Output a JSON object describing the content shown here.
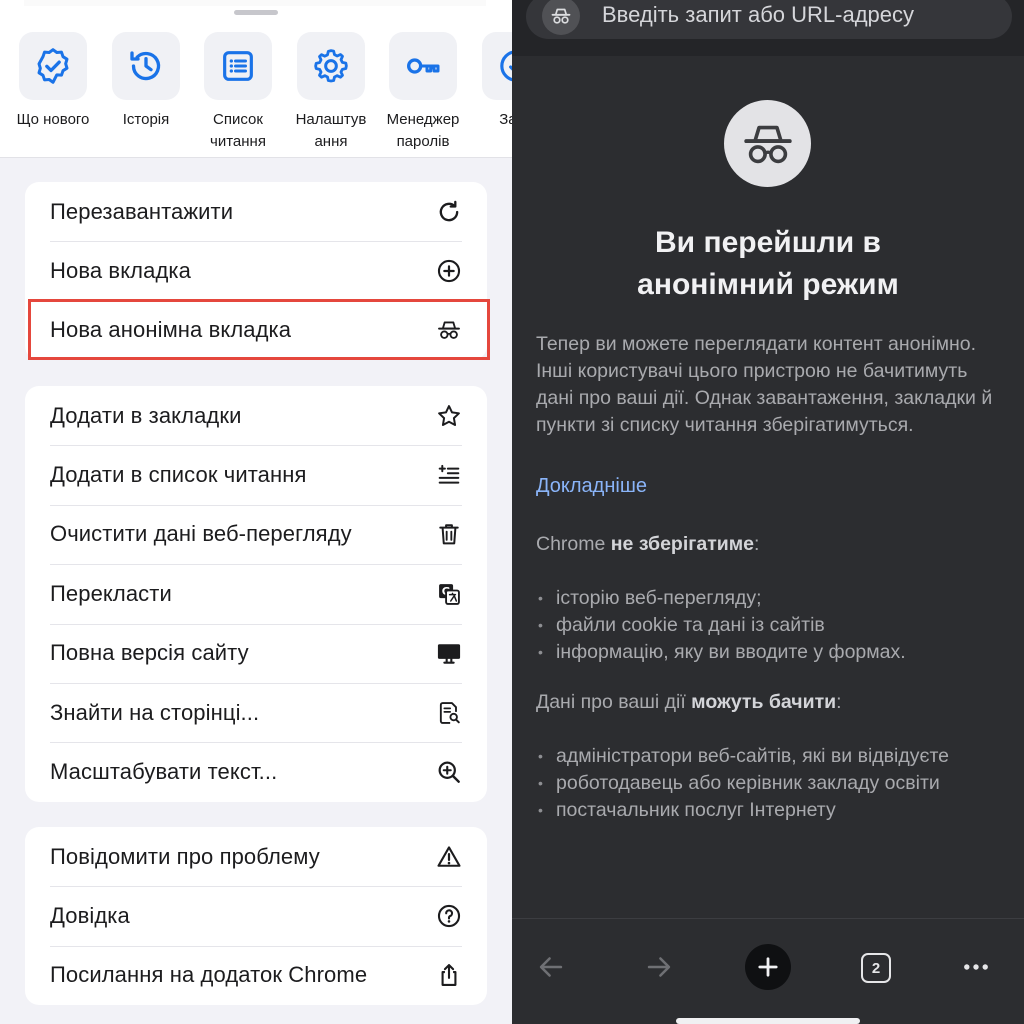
{
  "menu": {
    "quick_actions": [
      {
        "label": "Що нового",
        "icon": "verified-badge-icon"
      },
      {
        "label": "Історія",
        "icon": "history-icon"
      },
      {
        "label": "Список\nчитання",
        "icon": "reading-list-icon"
      },
      {
        "label": "Налаштув\nання",
        "icon": "gear-icon"
      },
      {
        "label": "Менеджер\nпаролів",
        "icon": "key-icon"
      },
      {
        "label": "Зава\nн",
        "icon": "download-icon"
      }
    ],
    "group1": [
      {
        "label": "Перезавантажити",
        "icon": "reload-icon"
      },
      {
        "label": "Нова вкладка",
        "icon": "plus-circle-icon"
      },
      {
        "label": "Нова анонімна вкладка",
        "icon": "incognito-icon"
      }
    ],
    "group2": [
      {
        "label": "Додати в закладки",
        "icon": "star-icon"
      },
      {
        "label": "Додати в список читання",
        "icon": "reading-list-add-icon"
      },
      {
        "label": "Очистити дані веб-перегляду",
        "icon": "trash-icon"
      },
      {
        "label": "Перекласти",
        "icon": "translate-icon"
      },
      {
        "label": "Повна версія сайту",
        "icon": "desktop-icon"
      },
      {
        "label": "Знайти на сторінці...",
        "icon": "find-in-page-icon"
      },
      {
        "label": "Масштабувати текст...",
        "icon": "zoom-in-icon"
      }
    ],
    "group3": [
      {
        "label": "Повідомити про проблему",
        "icon": "warning-icon"
      },
      {
        "label": "Довідка",
        "icon": "help-icon"
      },
      {
        "label": "Посилання на додаток Chrome",
        "icon": "share-icon"
      }
    ],
    "highlight_color": "#e5473d"
  },
  "incognito": {
    "omnibox_placeholder": "Введіть запит або URL-адресу",
    "title_line1": "Ви перейшли в",
    "title_line2": "анонімний режим",
    "intro": "Тепер ви можете переглядати контент анонімно. Інші користувачі цього пристрою не бачитимуть дані про ваші дії. Однак завантаження, закладки й пункти зі списку читання зберігатимуться.",
    "learn_more": "Докладніше",
    "not_save_prefix": "Chrome ",
    "not_save_bold": "не зберігатиме",
    "not_save_suffix": ":",
    "not_saved_items": [
      "історію веб-перегляду;",
      "файли cookie та дані із сайтів",
      "інформацію, яку ви вводите у формах."
    ],
    "visible_prefix": "Дані про ваші дії ",
    "visible_bold": "можуть бачити",
    "visible_suffix": ":",
    "visible_items": [
      "адміністратори веб-сайтів, які ви відвідуєте",
      "роботодавець або керівник закладу освіти",
      "постачальник послуг Інтернету"
    ],
    "tab_count": "2"
  },
  "colors": {
    "accent_blue": "#1a73e8",
    "link_blue": "#8ab4f8",
    "incognito_bg": "#2c2d30"
  }
}
